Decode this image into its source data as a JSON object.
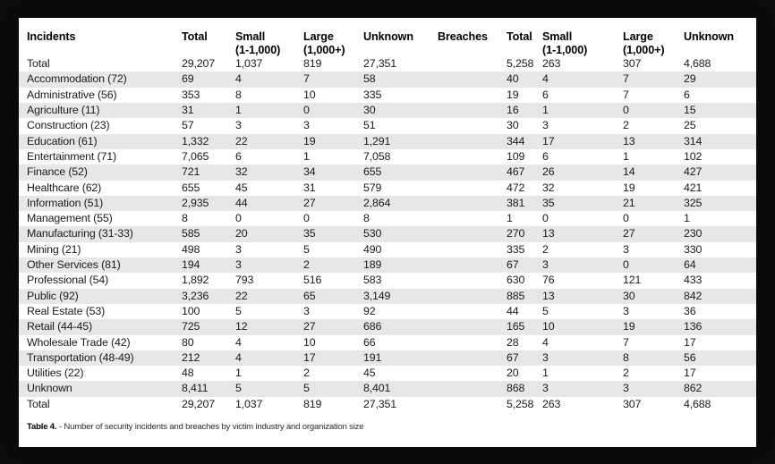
{
  "caption": {
    "label": "Table 4.",
    "text": " - Number of security incidents and breaches by victim industry and organization size"
  },
  "colors": {
    "stripe": "#e7e7e7",
    "background": "#ffffff",
    "frame": "#0a0a0a",
    "text": "#1a1a1a"
  },
  "table": {
    "headers": {
      "incidents": "Incidents",
      "incidents_total": "Total",
      "incidents_small": "Small",
      "incidents_small_sub": "(1-1,000)",
      "incidents_large": "Large",
      "incidents_large_sub": "(1,000+)",
      "incidents_unknown": "Unknown",
      "breaches": "Breaches",
      "breaches_total": "Total",
      "breaches_small": "Small",
      "breaches_small_sub": "(1-1,000)",
      "breaches_large": "Large",
      "breaches_large_sub": "(1,000+)",
      "breaches_unknown": "Unknown"
    },
    "rows": [
      {
        "industry": "Total",
        "i_total": "29,207",
        "i_small": "1,037",
        "i_large": "819",
        "i_unknown": "27,351",
        "b_total": "5,258",
        "b_small": "263",
        "b_large": "307",
        "b_unknown": "4,688"
      },
      {
        "industry": "Accommodation (72)",
        "i_total": "69",
        "i_small": "4",
        "i_large": "7",
        "i_unknown": "58",
        "b_total": "40",
        "b_small": "4",
        "b_large": "7",
        "b_unknown": "29"
      },
      {
        "industry": "Administrative (56)",
        "i_total": "353",
        "i_small": "8",
        "i_large": "10",
        "i_unknown": "335",
        "b_total": "19",
        "b_small": "6",
        "b_large": "7",
        "b_unknown": "6"
      },
      {
        "industry": "Agriculture (11)",
        "i_total": "31",
        "i_small": "1",
        "i_large": "0",
        "i_unknown": "30",
        "b_total": "16",
        "b_small": "1",
        "b_large": "0",
        "b_unknown": "15"
      },
      {
        "industry": "Construction (23)",
        "i_total": "57",
        "i_small": "3",
        "i_large": "3",
        "i_unknown": "51",
        "b_total": "30",
        "b_small": "3",
        "b_large": "2",
        "b_unknown": "25"
      },
      {
        "industry": "Education (61)",
        "i_total": "1,332",
        "i_small": "22",
        "i_large": "19",
        "i_unknown": "1,291",
        "b_total": "344",
        "b_small": "17",
        "b_large": "13",
        "b_unknown": "314"
      },
      {
        "industry": "Entertainment (71)",
        "i_total": "7,065",
        "i_small": "6",
        "i_large": "1",
        "i_unknown": "7,058",
        "b_total": "109",
        "b_small": "6",
        "b_large": "1",
        "b_unknown": "102"
      },
      {
        "industry": "Finance (52)",
        "i_total": "721",
        "i_small": "32",
        "i_large": "34",
        "i_unknown": "655",
        "b_total": "467",
        "b_small": "26",
        "b_large": "14",
        "b_unknown": "427"
      },
      {
        "industry": "Healthcare (62)",
        "i_total": "655",
        "i_small": "45",
        "i_large": "31",
        "i_unknown": "579",
        "b_total": "472",
        "b_small": "32",
        "b_large": "19",
        "b_unknown": "421"
      },
      {
        "industry": "Information (51)",
        "i_total": "2,935",
        "i_small": "44",
        "i_large": "27",
        "i_unknown": "2,864",
        "b_total": "381",
        "b_small": "35",
        "b_large": "21",
        "b_unknown": "325"
      },
      {
        "industry": "Management (55)",
        "i_total": "8",
        "i_small": "0",
        "i_large": "0",
        "i_unknown": "8",
        "b_total": "1",
        "b_small": "0",
        "b_large": "0",
        "b_unknown": "1"
      },
      {
        "industry": "Manufacturing (31-33)",
        "i_total": "585",
        "i_small": "20",
        "i_large": "35",
        "i_unknown": "530",
        "b_total": "270",
        "b_small": "13",
        "b_large": "27",
        "b_unknown": "230"
      },
      {
        "industry": "Mining (21)",
        "i_total": "498",
        "i_small": "3",
        "i_large": "5",
        "i_unknown": "490",
        "b_total": "335",
        "b_small": "2",
        "b_large": "3",
        "b_unknown": "330"
      },
      {
        "industry": "Other Services (81)",
        "i_total": "194",
        "i_small": "3",
        "i_large": "2",
        "i_unknown": "189",
        "b_total": "67",
        "b_small": "3",
        "b_large": "0",
        "b_unknown": "64"
      },
      {
        "industry": "Professional (54)",
        "i_total": "1,892",
        "i_small": "793",
        "i_large": "516",
        "i_unknown": "583",
        "b_total": "630",
        "b_small": "76",
        "b_large": "121",
        "b_unknown": "433"
      },
      {
        "industry": "Public (92)",
        "i_total": "3,236",
        "i_small": "22",
        "i_large": "65",
        "i_unknown": "3,149",
        "b_total": "885",
        "b_small": "13",
        "b_large": "30",
        "b_unknown": "842"
      },
      {
        "industry": "Real Estate (53)",
        "i_total": "100",
        "i_small": "5",
        "i_large": "3",
        "i_unknown": "92",
        "b_total": "44",
        "b_small": "5",
        "b_large": "3",
        "b_unknown": "36"
      },
      {
        "industry": "Retail (44-45)",
        "i_total": "725",
        "i_small": "12",
        "i_large": "27",
        "i_unknown": "686",
        "b_total": "165",
        "b_small": "10",
        "b_large": "19",
        "b_unknown": "136"
      },
      {
        "industry": "Wholesale Trade (42)",
        "i_total": "80",
        "i_small": "4",
        "i_large": "10",
        "i_unknown": "66",
        "b_total": "28",
        "b_small": "4",
        "b_large": "7",
        "b_unknown": "17"
      },
      {
        "industry": "Transportation (48-49)",
        "i_total": "212",
        "i_small": "4",
        "i_large": "17",
        "i_unknown": "191",
        "b_total": "67",
        "b_small": "3",
        "b_large": "8",
        "b_unknown": "56"
      },
      {
        "industry": "Utilities (22)",
        "i_total": "48",
        "i_small": "1",
        "i_large": "2",
        "i_unknown": "45",
        "b_total": "20",
        "b_small": "1",
        "b_large": "2",
        "b_unknown": "17"
      },
      {
        "industry": "Unknown",
        "i_total": "8,411",
        "i_small": "5",
        "i_large": "5",
        "i_unknown": "8,401",
        "b_total": "868",
        "b_small": "3",
        "b_large": "3",
        "b_unknown": "862"
      },
      {
        "industry": "Total",
        "i_total": "29,207",
        "i_small": "1,037",
        "i_large": "819",
        "i_unknown": "27,351",
        "b_total": "5,258",
        "b_small": "263",
        "b_large": "307",
        "b_unknown": "4,688"
      }
    ]
  },
  "chart_data": {
    "type": "table",
    "title": "Table 4. - Number of security incidents and breaches by victim industry and organization size",
    "columns": [
      "Incidents",
      "Total",
      "Small (1-1,000)",
      "Large (1,000+)",
      "Unknown",
      "Breaches",
      "Total",
      "Small (1-1,000)",
      "Large (1,000+)",
      "Unknown"
    ],
    "categories": [
      "Total",
      "Accommodation (72)",
      "Administrative (56)",
      "Agriculture (11)",
      "Construction (23)",
      "Education (61)",
      "Entertainment (71)",
      "Finance (52)",
      "Healthcare (62)",
      "Information (51)",
      "Management (55)",
      "Manufacturing (31-33)",
      "Mining (21)",
      "Other Services (81)",
      "Professional (54)",
      "Public (92)",
      "Real Estate (53)",
      "Retail (44-45)",
      "Wholesale Trade (42)",
      "Transportation (48-49)",
      "Utilities (22)",
      "Unknown",
      "Total"
    ],
    "series": [
      {
        "name": "Incidents Total",
        "values": [
          29207,
          69,
          353,
          31,
          57,
          1332,
          7065,
          721,
          655,
          2935,
          8,
          585,
          498,
          194,
          1892,
          3236,
          100,
          725,
          80,
          212,
          48,
          8411,
          29207
        ]
      },
      {
        "name": "Incidents Small (1-1,000)",
        "values": [
          1037,
          4,
          8,
          1,
          3,
          22,
          6,
          32,
          45,
          44,
          0,
          20,
          3,
          3,
          793,
          22,
          5,
          12,
          4,
          4,
          1,
          5,
          1037
        ]
      },
      {
        "name": "Incidents Large (1,000+)",
        "values": [
          819,
          7,
          10,
          0,
          3,
          19,
          1,
          34,
          31,
          27,
          0,
          35,
          5,
          2,
          516,
          65,
          3,
          27,
          10,
          17,
          2,
          5,
          819
        ]
      },
      {
        "name": "Incidents Unknown",
        "values": [
          27351,
          58,
          335,
          30,
          51,
          1291,
          7058,
          655,
          579,
          2864,
          8,
          530,
          490,
          189,
          583,
          3149,
          92,
          686,
          66,
          191,
          45,
          8401,
          27351
        ]
      },
      {
        "name": "Breaches Total",
        "values": [
          5258,
          40,
          19,
          16,
          30,
          344,
          109,
          467,
          472,
          381,
          1,
          270,
          335,
          67,
          630,
          885,
          44,
          165,
          28,
          67,
          20,
          868,
          5258
        ]
      },
      {
        "name": "Breaches Small (1-1,000)",
        "values": [
          263,
          4,
          6,
          1,
          3,
          17,
          6,
          26,
          32,
          35,
          0,
          13,
          2,
          3,
          76,
          13,
          5,
          10,
          4,
          3,
          1,
          3,
          263
        ]
      },
      {
        "name": "Breaches Large (1,000+)",
        "values": [
          307,
          7,
          7,
          0,
          2,
          13,
          1,
          14,
          19,
          21,
          0,
          27,
          3,
          0,
          121,
          30,
          3,
          19,
          7,
          8,
          2,
          3,
          307
        ]
      },
      {
        "name": "Breaches Unknown",
        "values": [
          4688,
          29,
          6,
          15,
          25,
          314,
          102,
          427,
          421,
          325,
          1,
          230,
          330,
          64,
          433,
          842,
          36,
          136,
          17,
          56,
          17,
          862,
          4688
        ]
      }
    ]
  }
}
